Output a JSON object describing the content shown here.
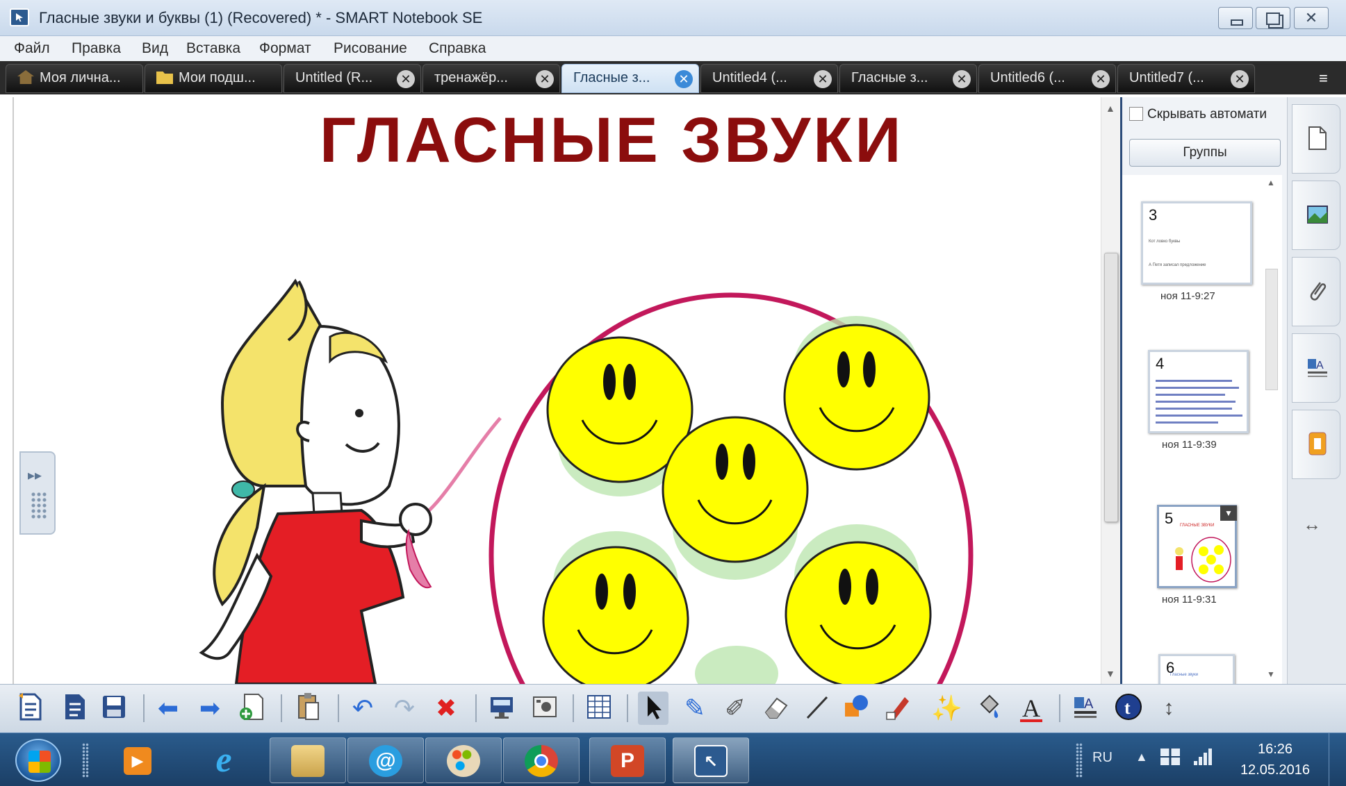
{
  "window": {
    "title": "Гласные звуки и буквы (1) (Recovered) * - SMART Notebook SE"
  },
  "menu": [
    "Файл",
    "Правка",
    "Вид",
    "Вставка",
    "Формат",
    "Рисование",
    "Справка"
  ],
  "tabs": [
    {
      "label": "Моя лична...",
      "icon": "house-icon",
      "closable": false
    },
    {
      "label": "Мои подш...",
      "icon": "folder-icon",
      "closable": false
    },
    {
      "label": "Untitled (R...",
      "closable": true
    },
    {
      "label": "тренажёр...",
      "closable": true
    },
    {
      "label": "Гласные з...",
      "closable": true,
      "active": true
    },
    {
      "label": "Untitled4 (...",
      "closable": true
    },
    {
      "label": "Гласные з...",
      "closable": true
    },
    {
      "label": "Untitled6 (...",
      "closable": true
    },
    {
      "label": "Untitled7 (...",
      "closable": true
    }
  ],
  "slide": {
    "title": "ГЛАСНЫЕ  ЗВУКИ"
  },
  "sidepanel": {
    "autohide_label": "Скрывать автомати",
    "groups_button": "Группы",
    "thumbnails": [
      {
        "number": "3",
        "time": "ноя 11-9:27",
        "lines": [
          "Кот ловко буквы",
          "А Петя записал предложение"
        ]
      },
      {
        "number": "4",
        "time": "ноя 11-9:39"
      },
      {
        "number": "5",
        "time": "ноя 11-9:31",
        "mini_title": "ГЛАСНЫЕ ЗВУКИ"
      },
      {
        "number": "6",
        "mini_title": "Гласные звуки"
      }
    ]
  },
  "side_tabs": [
    "page-sorter-icon",
    "gallery-icon",
    "attachments-icon",
    "properties-icon",
    "addons-icon"
  ],
  "toolbar_icons": [
    "new-page-icon",
    "open-icon",
    "save-icon",
    "back-icon",
    "forward-icon",
    "add-page-icon",
    "paste-icon",
    "undo-icon",
    "redo-icon",
    "delete-icon",
    "screen-shade-icon",
    "screen-capture-icon",
    "table-icon",
    "select-icon",
    "pen-icon",
    "creative-pen-icon",
    "eraser-icon",
    "line-icon",
    "shapes-icon",
    "magic-pen-icon",
    "magic-wand-icon",
    "fill-icon",
    "text-icon",
    "properties-icon",
    "info-icon",
    "move-toolbar-icon"
  ],
  "taskbar": {
    "apps": [
      "media-player-icon",
      "internet-explorer-icon",
      "file-explorer-icon",
      "mail-icon",
      "paint-icon",
      "chrome-icon",
      "powerpoint-icon",
      "smart-notebook-icon"
    ],
    "lang": "RU",
    "time": "16:26",
    "date": "12.05.2016"
  },
  "colors": {
    "title_red": "#8b0d0d",
    "smiley_yellow": "#ffff00",
    "circle_pink": "#c2185b",
    "taskbar_blue": "#1b3f66"
  }
}
